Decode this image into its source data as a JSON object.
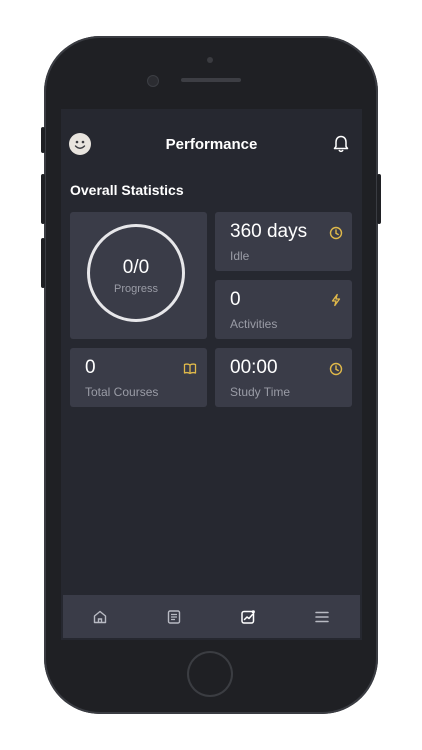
{
  "header": {
    "title": "Performance",
    "avatar_icon": "smiley-face-icon",
    "notification_icon": "bell-icon"
  },
  "section": {
    "title": "Overall Statistics"
  },
  "stats": {
    "progress": {
      "value": "0/0",
      "label": "Progress"
    },
    "idle": {
      "value": "360 days",
      "label": "Idle",
      "icon": "clock-icon"
    },
    "activities": {
      "value": "0",
      "label": "Activities",
      "icon": "lightning-icon"
    },
    "total_courses": {
      "value": "0",
      "label": "Total Courses",
      "icon": "book-icon"
    },
    "study_time": {
      "value": "00:00",
      "label": "Study Time",
      "icon": "clock-icon"
    }
  },
  "bottom_nav": [
    {
      "icon": "home-icon",
      "active": false
    },
    {
      "icon": "document-icon",
      "active": false
    },
    {
      "icon": "chart-icon",
      "active": true
    },
    {
      "icon": "menu-icon",
      "active": false
    }
  ],
  "colors": {
    "screen_bg": "#262830",
    "card_bg": "#3a3c48",
    "accent": "#e0b94a",
    "text_primary": "#ffffff",
    "text_secondary": "#9a9ca6"
  }
}
